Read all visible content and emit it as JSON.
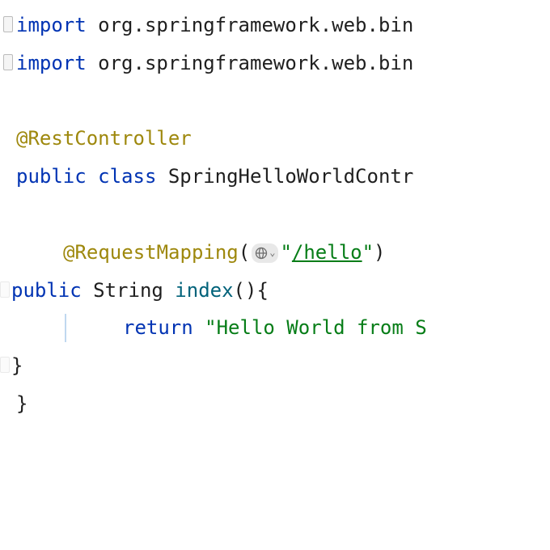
{
  "code": {
    "line1": {
      "keyword": "import",
      "rest": " org.springframework.web.bin"
    },
    "line2": {
      "keyword": "import",
      "rest": " org.springframework.web.bin"
    },
    "line4": {
      "annotation": "@RestController"
    },
    "line5": {
      "public": "public",
      "class": "class",
      "name": " SpringHelloWorldContr"
    },
    "line7": {
      "annotation": "@RequestMapping",
      "paren_open": "(",
      "string_open": "\"",
      "url": "/hello",
      "string_close": "\"",
      "paren_close": ")"
    },
    "line8": {
      "public": "public",
      "type": " String ",
      "method": "index",
      "parens": "()",
      "brace": "{"
    },
    "line9": {
      "return": "return",
      "string": " \"Hello World from S"
    },
    "line10": {
      "brace": "}"
    },
    "line11": {
      "brace": "}"
    }
  }
}
